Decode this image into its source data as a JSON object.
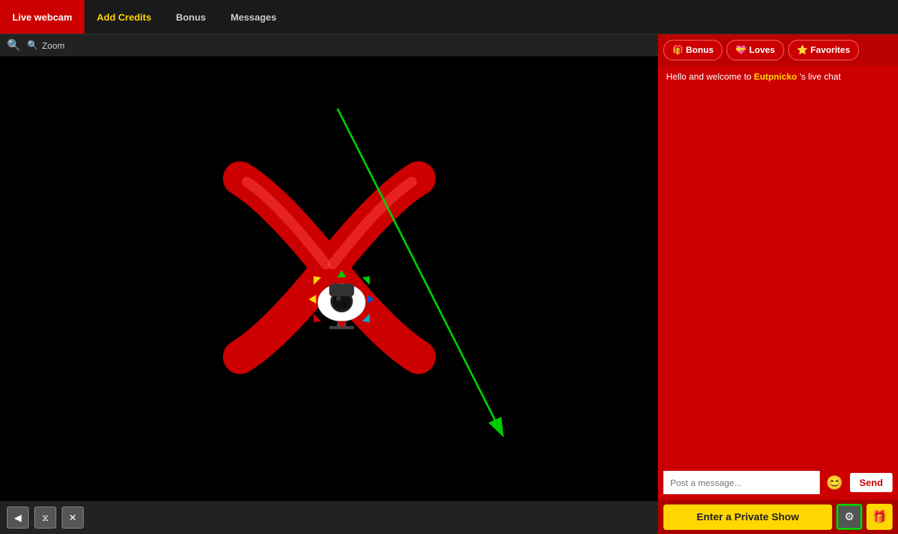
{
  "nav": {
    "items": [
      {
        "id": "live-webcam",
        "label": "Live webcam",
        "active": true
      },
      {
        "id": "add-credits",
        "label": "Add Credits",
        "highlight": true
      },
      {
        "id": "bonus",
        "label": "Bonus",
        "active": false
      },
      {
        "id": "messages",
        "label": "Messages",
        "active": false
      }
    ]
  },
  "toolbar": {
    "search_icon": "🔍",
    "zoom_label": "Zoom"
  },
  "bottom_controls": [
    {
      "id": "back",
      "icon": "◀"
    },
    {
      "id": "adjust",
      "icon": "⧖"
    },
    {
      "id": "close",
      "icon": "✕"
    }
  ],
  "chat": {
    "bonus_label": "🎁 Bonus",
    "loves_label": "💝 Loves",
    "favorites_label": "⭐ Favorites",
    "welcome_text_prefix": "Hello and welcome to ",
    "username": "Eutpnicko",
    "welcome_text_suffix": " 's live chat",
    "input_placeholder": "Post a message...",
    "send_label": "Send",
    "emoji_icon": "😊",
    "private_show_label": "Enter a Private Show",
    "settings_icon": "⚙",
    "gift_icon": "🎁"
  }
}
